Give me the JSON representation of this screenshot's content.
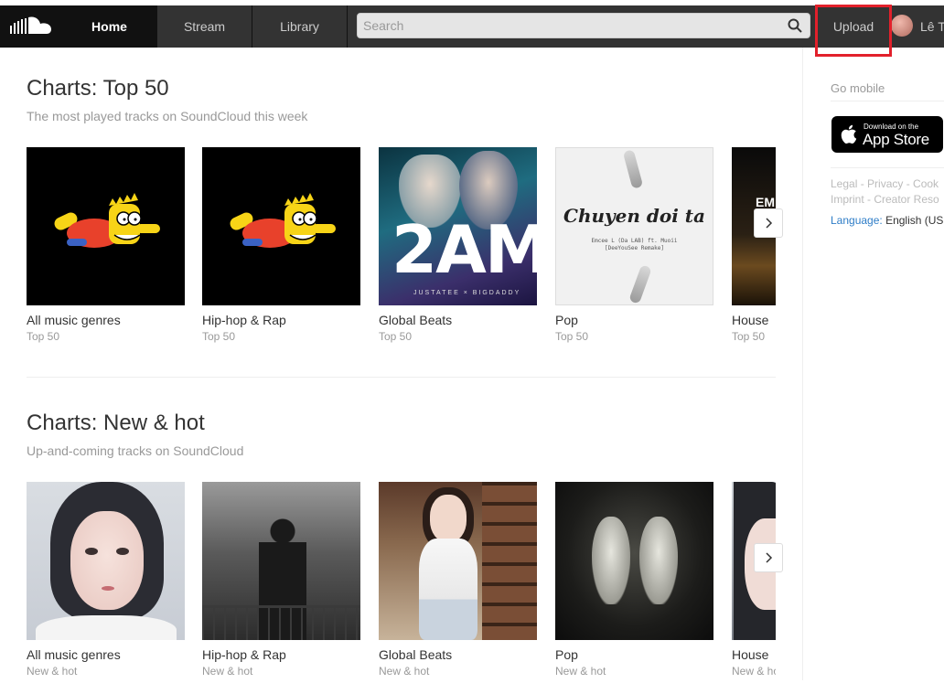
{
  "header": {
    "nav": [
      "Home",
      "Stream",
      "Library"
    ],
    "search_placeholder": "Search",
    "upload_label": "Upload",
    "username": "Lê T"
  },
  "sections": [
    {
      "title": "Charts: Top 50",
      "subtitle": "The most played tracks on SoundCloud this week",
      "cards": [
        {
          "title": "All music genres",
          "subtitle": "Top 50"
        },
        {
          "title": "Hip-hop & Rap",
          "subtitle": "Top 50"
        },
        {
          "title": "Global Beats",
          "subtitle": "Top 50"
        },
        {
          "title": "Pop",
          "subtitle": "Top 50"
        },
        {
          "title": "House",
          "subtitle": "Top 50"
        }
      ]
    },
    {
      "title": "Charts: New & hot",
      "subtitle": "Up-and-coming tracks on SoundCloud",
      "cards": [
        {
          "title": "All music genres",
          "subtitle": "New & hot"
        },
        {
          "title": "Hip-hop & Rap",
          "subtitle": "New & hot"
        },
        {
          "title": "Global Beats",
          "subtitle": "New & hot"
        },
        {
          "title": "Pop",
          "subtitle": "New & hot"
        },
        {
          "title": "House",
          "subtitle": "New & ho"
        }
      ]
    }
  ],
  "artwork_text": {
    "global_beats_big": "2AM",
    "global_beats_small": "JUSTATEE × BIGDADDY",
    "pop_script": "Chuyen doi ta",
    "pop_tiny": "Emcee L (Da LAB) ft. Muoii\n[DeeYouSee Remake]",
    "house_text": "EM"
  },
  "sidebar": {
    "go_mobile": "Go mobile",
    "appstore_small": "Download on the",
    "appstore_big": "App Store",
    "legal_line1": "Legal - Privacy - Cook",
    "legal_line2": "Imprint - Creator Reso",
    "language_label": "Language:",
    "language_value": "English (US"
  },
  "colors": {
    "header_bg": "#333333",
    "active_tab_bg": "#111111",
    "highlight_border": "#e2202b",
    "link_blue": "#2e7dc7"
  }
}
